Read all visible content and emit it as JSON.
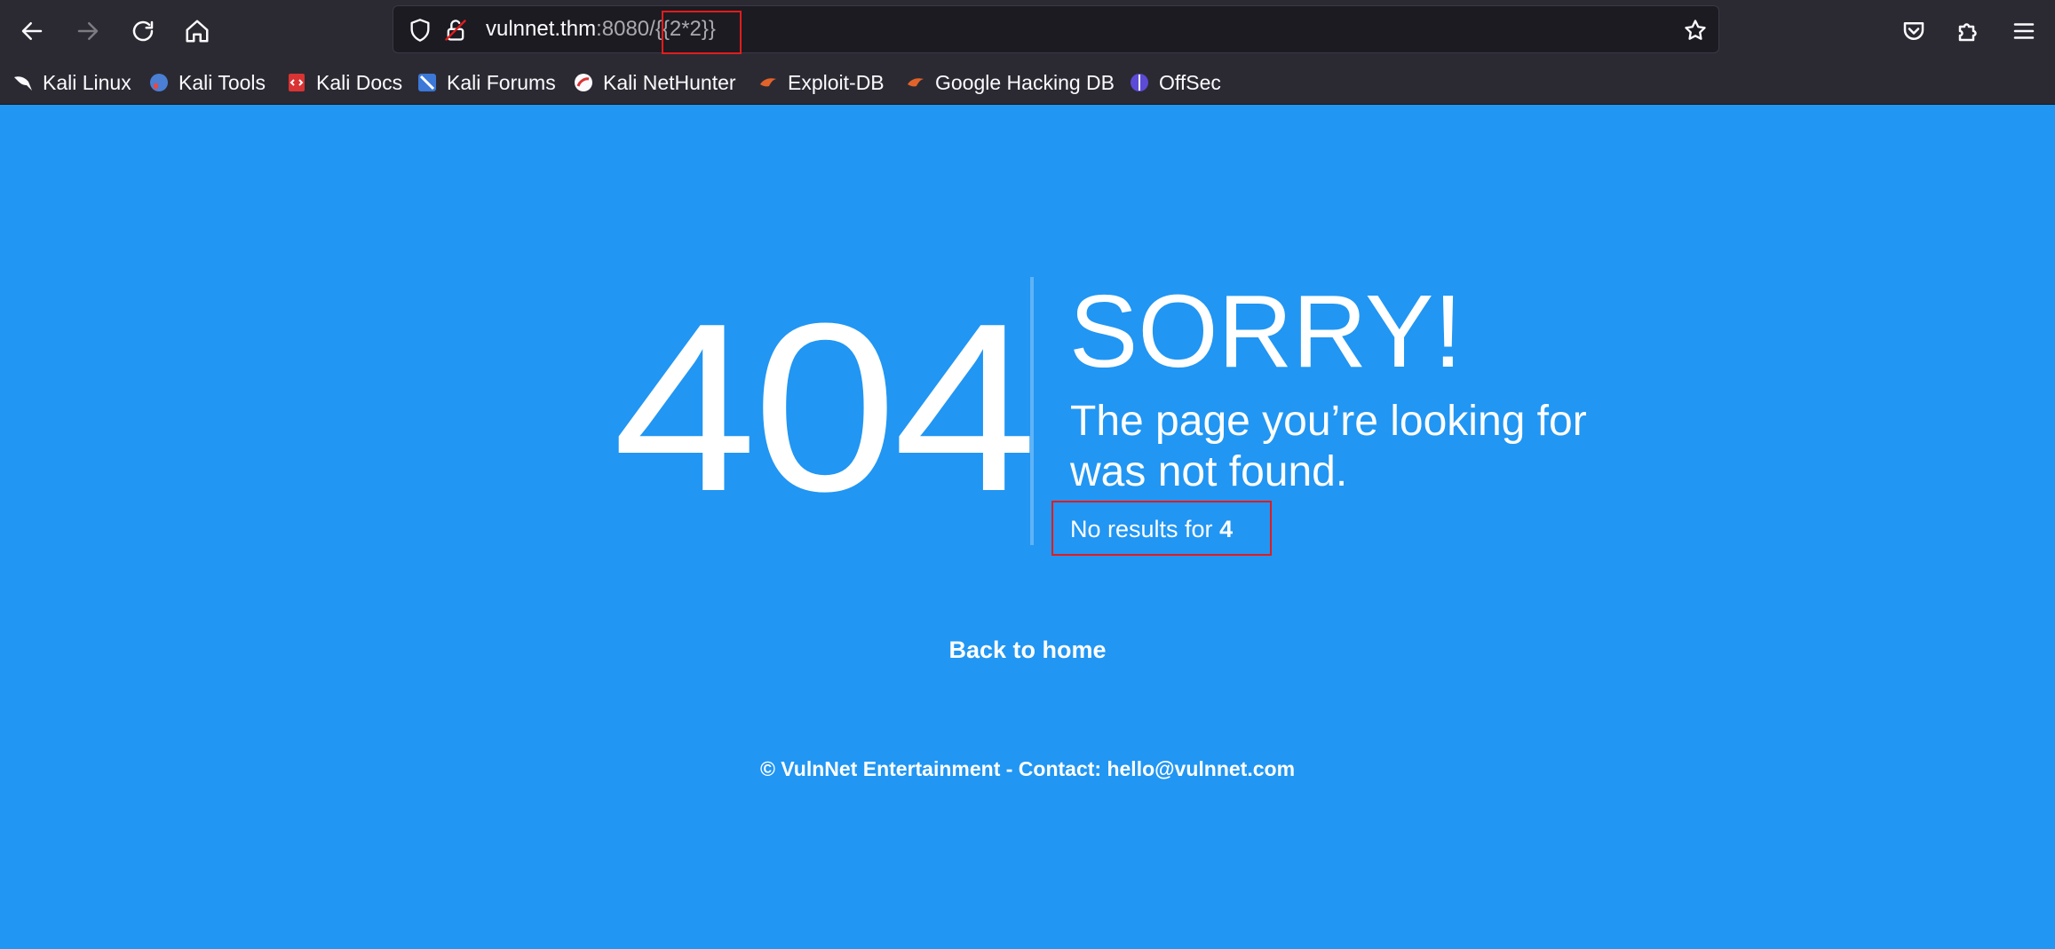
{
  "browser": {
    "url": {
      "host": "vulnnet.thm",
      "port_path": ":8080/",
      "payload": "{{2*2}}"
    },
    "bookmarks": [
      {
        "label": "Kali Linux",
        "icon": "kali-dragon-icon"
      },
      {
        "label": "Kali Tools",
        "icon": "kali-tools-icon"
      },
      {
        "label": "Kali Docs",
        "icon": "kali-docs-icon"
      },
      {
        "label": "Kali Forums",
        "icon": "kali-forums-icon"
      },
      {
        "label": "Kali NetHunter",
        "icon": "nethunter-icon"
      },
      {
        "label": "Exploit-DB",
        "icon": "exploit-db-icon"
      },
      {
        "label": "Google Hacking DB",
        "icon": "ghdb-icon"
      },
      {
        "label": "OffSec",
        "icon": "offsec-icon"
      }
    ]
  },
  "page": {
    "code": "404",
    "headline": "SORRY!",
    "message": "The page you’re looking for was not found.",
    "search_prefix": "No results for",
    "search_result": "4",
    "back_link": "Back to home",
    "footer": "© VulnNet Entertainment - Contact: hello@vulnnet.com"
  },
  "colors": {
    "page_background": "#2196f3",
    "chrome_background": "#2b2a33",
    "annotation_red": "#e21c1c"
  }
}
